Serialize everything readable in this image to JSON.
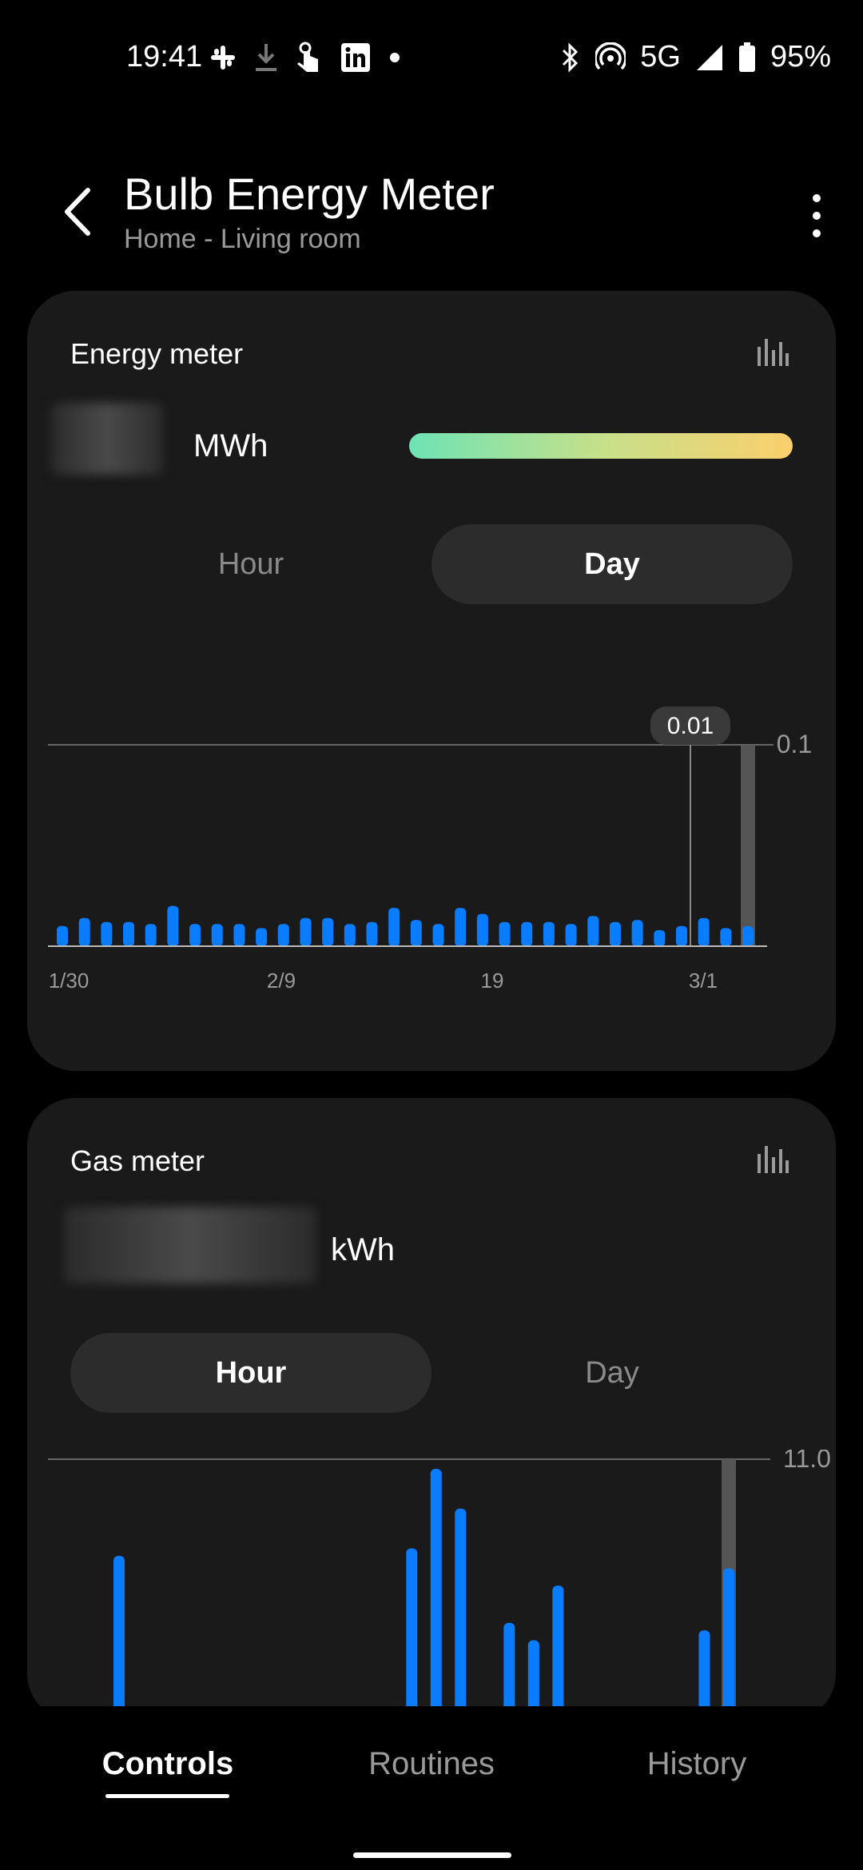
{
  "status": {
    "time": "19:41",
    "network": "5G",
    "battery": "95%",
    "icons": [
      "slack-icon",
      "download-icon",
      "touch-icon",
      "linkedin-icon",
      "dot-icon",
      "bluetooth-icon",
      "hotspot-icon",
      "signal-icon",
      "battery-icon"
    ]
  },
  "header": {
    "title": "Bulb Energy Meter",
    "subtitle": "Home - Living room"
  },
  "energy_card": {
    "title": "Energy meter",
    "unit": "MWh",
    "segments": [
      "Hour",
      "Day"
    ],
    "selected_segment": "Day"
  },
  "gas_card": {
    "title": "Gas meter",
    "unit": "kWh",
    "segments": [
      "Hour",
      "Day"
    ],
    "selected_segment": "Hour"
  },
  "chart_data": [
    {
      "type": "bar",
      "name": "energy-day",
      "ymax_label": "0.1",
      "ylim": [
        0,
        0.1
      ],
      "x_tick_labels": [
        "1/30",
        "2/9",
        "19",
        "3/1"
      ],
      "tooltip": "0.01",
      "values": [
        0.01,
        0.014,
        0.012,
        0.012,
        0.011,
        0.02,
        0.011,
        0.011,
        0.011,
        0.009,
        0.011,
        0.014,
        0.014,
        0.011,
        0.012,
        0.019,
        0.013,
        0.011,
        0.019,
        0.016,
        0.012,
        0.012,
        0.012,
        0.011,
        0.015,
        0.012,
        0.013,
        0.008,
        0.01,
        0.014,
        0.009,
        0.01
      ],
      "bar_color": "#0a7cff",
      "highlight_index": 31
    },
    {
      "type": "bar",
      "name": "gas-hour",
      "ymax_label": "11.0",
      "ylim": [
        0,
        11.0
      ],
      "values": [
        0,
        0,
        7.5,
        0.6,
        0,
        0,
        0,
        0,
        0,
        0,
        0,
        0,
        0,
        0,
        7.8,
        11.0,
        9.4,
        1.4,
        4.8,
        4.1,
        6.3,
        1.1,
        0,
        0,
        0,
        0.6,
        4.5,
        7.0
      ],
      "bar_color": "#0a7cff",
      "highlight_index": 27
    }
  ],
  "bottom_nav": {
    "items": [
      "Controls",
      "Routines",
      "History"
    ],
    "active": "Controls"
  }
}
